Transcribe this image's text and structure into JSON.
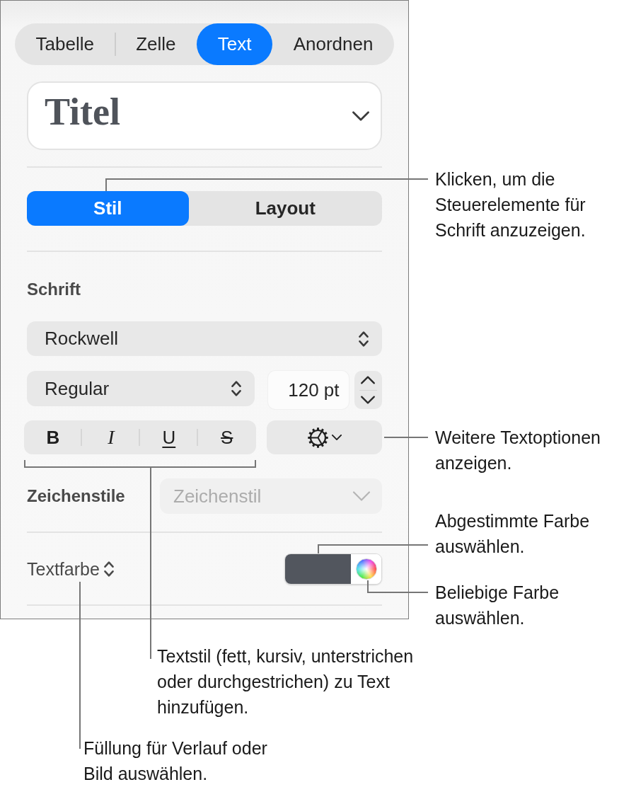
{
  "inspector": {
    "tabs": [
      {
        "label": "Tabelle",
        "selected": false
      },
      {
        "label": "Zelle",
        "selected": false
      },
      {
        "label": "Text",
        "selected": true
      },
      {
        "label": "Anordnen",
        "selected": false
      }
    ],
    "paragraph_style": {
      "value": "Titel"
    },
    "sub_tabs": [
      {
        "label": "Stil",
        "selected": true
      },
      {
        "label": "Layout",
        "selected": false
      }
    ],
    "font": {
      "heading": "Schrift",
      "family": "Rockwell",
      "typeface": "Regular",
      "size": "120 pt",
      "style_buttons": [
        {
          "label": "B",
          "kind": "bold"
        },
        {
          "label": "I",
          "kind": "italic"
        },
        {
          "label": "U",
          "kind": "underline"
        },
        {
          "label": "S",
          "kind": "strikethrough"
        }
      ]
    },
    "character_styles": {
      "label": "Zeichenstile",
      "placeholder": "Zeichenstil",
      "disabled": true
    },
    "text_color": {
      "label": "Textfarbe",
      "color": "#52565e"
    }
  },
  "callouts": [
    {
      "text": "Klicken, um die Steuerelemente für Schrift anzuzeigen."
    },
    {
      "text": "Weitere Textoptionen anzeigen."
    },
    {
      "text": "Abgestimmte Farbe auswählen."
    },
    {
      "text": "Beliebige Farbe auswählen."
    },
    {
      "text": "Textstil (fett, kursiv, unterstrichen oder durchgestrichen) zu Text hinzufügen."
    },
    {
      "text": "Füllung für Verlauf oder Bild auswählen."
    }
  ]
}
